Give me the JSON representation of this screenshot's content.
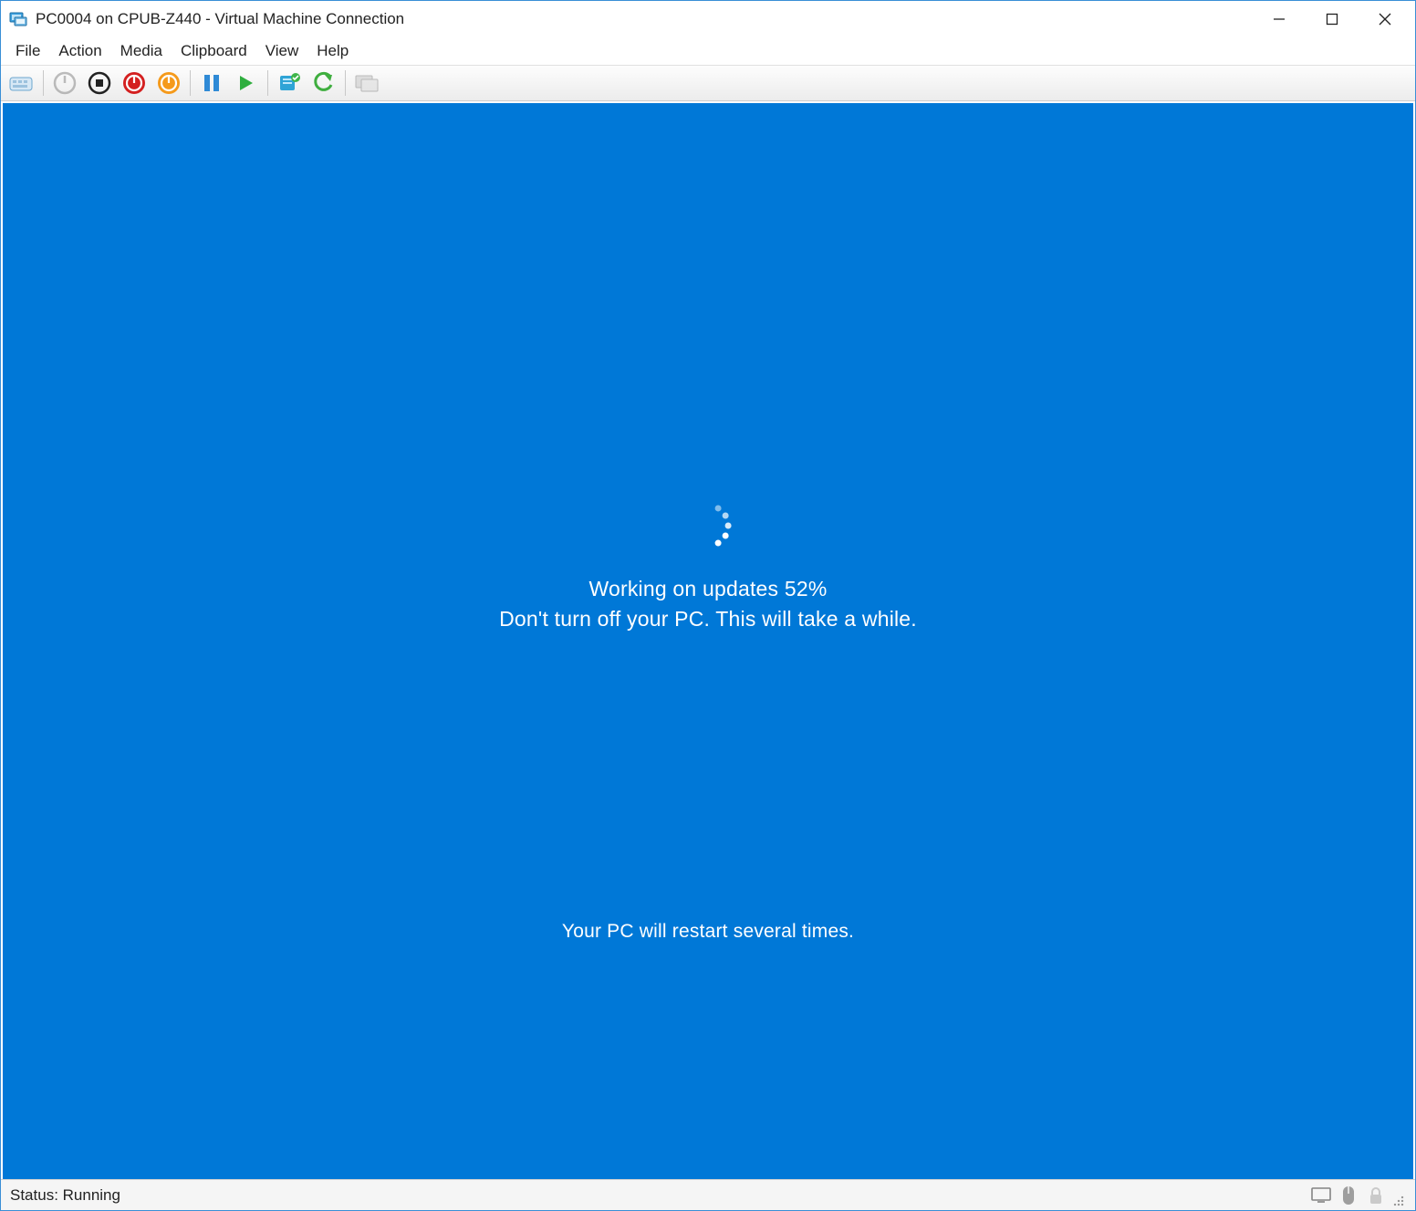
{
  "window": {
    "title": "PC0004 on CPUB-Z440 - Virtual Machine Connection"
  },
  "menu": {
    "items": [
      "File",
      "Action",
      "Media",
      "Clipboard",
      "View",
      "Help"
    ]
  },
  "toolbar": {
    "ctrl_alt_del": "Ctrl+Alt+Del",
    "start": "Start",
    "turn_off": "Turn Off",
    "shutdown": "Shut Down",
    "save": "Save",
    "pause": "Pause",
    "reset": "Reset",
    "checkpoint": "Checkpoint",
    "revert": "Revert",
    "enhanced": "Enhanced Session"
  },
  "guest": {
    "update_line1_prefix": "Working on updates ",
    "update_percent": "52%",
    "update_line2": "Don't turn off your PC. This will take a while.",
    "update_bottom": "Your PC will restart several times.",
    "bg_color": "#0078d7"
  },
  "status": {
    "text": "Status: Running"
  }
}
